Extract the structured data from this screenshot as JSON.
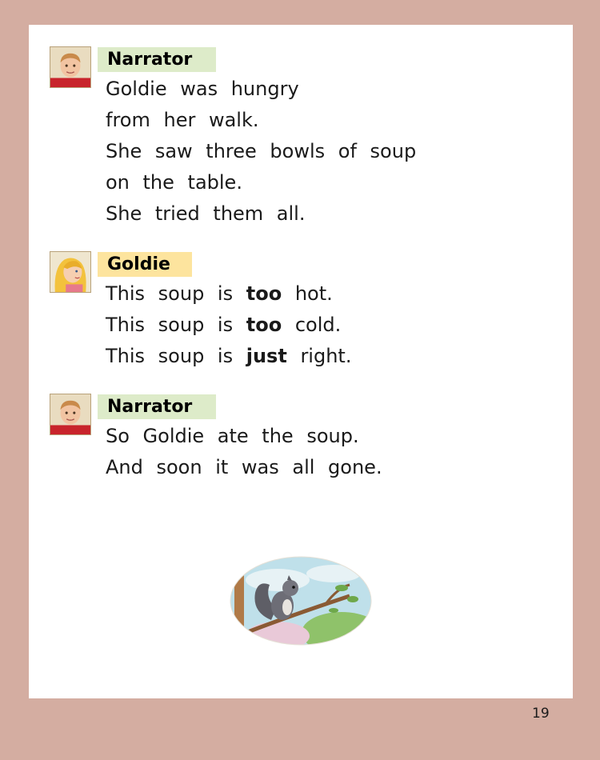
{
  "blocks": [
    {
      "speaker": "Narrator",
      "avatar_icon": "boy-portrait-icon",
      "lines": [
        [
          {
            "t": "Goldie was hungry"
          }
        ],
        [
          {
            "t": "from her walk."
          }
        ],
        [
          {
            "t": "She saw three bowls of soup"
          }
        ],
        [
          {
            "t": "on the table."
          }
        ],
        [
          {
            "t": "She tried them all."
          }
        ]
      ]
    },
    {
      "speaker": "Goldie",
      "avatar_icon": "girl-portrait-icon",
      "lines": [
        [
          {
            "t": "This soup is "
          },
          {
            "t": "too",
            "b": true
          },
          {
            "t": " hot."
          }
        ],
        [
          {
            "t": "This soup is "
          },
          {
            "t": "too",
            "b": true
          },
          {
            "t": " cold."
          }
        ],
        [
          {
            "t": "This soup is "
          },
          {
            "t": "just",
            "b": true
          },
          {
            "t": " right."
          }
        ]
      ]
    },
    {
      "speaker": "Narrator",
      "avatar_icon": "boy-portrait-icon",
      "lines": [
        [
          {
            "t": "So Goldie ate the soup."
          }
        ],
        [
          {
            "t": "And soon it was all gone."
          }
        ]
      ]
    }
  ],
  "illustration_icon": "squirrel-illustration",
  "page_number": "19",
  "colors": {
    "border": "#d4ada1",
    "narrator_label_bg": "#ddebc9",
    "goldie_label_bg": "#fde49e",
    "page_bg": "#ffffff"
  }
}
